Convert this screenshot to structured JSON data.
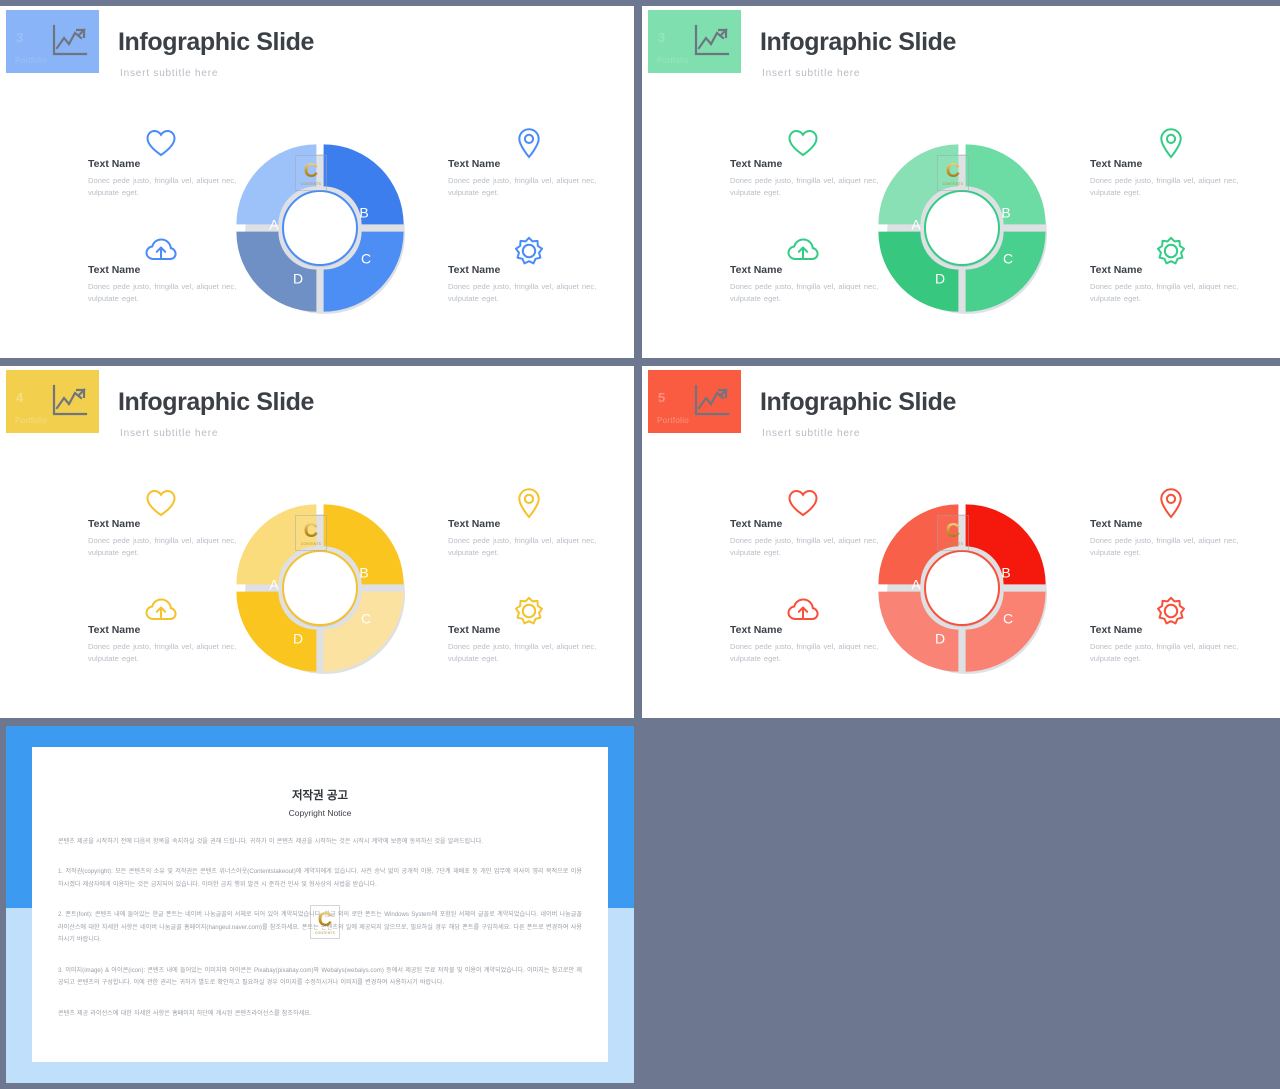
{
  "background_color": "#6d7890",
  "slides": [
    {
      "number": "3",
      "kicker": "Portfolio",
      "title": "Infographic Slide",
      "subtitle": "Insert  subtitle  here",
      "accent": "#4a8cf7",
      "badge_bg": "#89b4f7",
      "badge_text_color": "#9cc0f8",
      "chart_icon": "line-chart-icon",
      "segments": [
        {
          "label": "A",
          "color": "#9dc2fa"
        },
        {
          "label": "B",
          "color": "#3d7eee"
        },
        {
          "label": "C",
          "color": "#4d8ef5"
        },
        {
          "label": "D",
          "color": "#6f90c4"
        }
      ],
      "items": [
        {
          "icon": "heart-icon",
          "name": "Text Name",
          "desc": "Donec pede justo, fringilla vel, aliquet nec, vulputate eget."
        },
        {
          "icon": "cloud-upload-icon",
          "name": "Text Name",
          "desc": "Donec pede justo, fringilla vel, aliquet nec, vulputate eget."
        },
        {
          "icon": "map-pin-icon",
          "name": "Text Name",
          "desc": "Donec pede justo, fringilla vel, aliquet nec, vulputate eget."
        },
        {
          "icon": "gear-badge-icon",
          "name": "Text Name",
          "desc": "Donec pede justo, fringilla vel, aliquet nec, vulputate eget."
        }
      ]
    },
    {
      "number": "3",
      "kicker": "Portfolio",
      "title": "Infographic Slide",
      "subtitle": "Insert  subtitle  here",
      "accent": "#33cc85",
      "badge_bg": "#7fdfaf",
      "badge_text_color": "#96e6bf",
      "chart_icon": "line-chart-icon",
      "segments": [
        {
          "label": "A",
          "color": "#88e0b4"
        },
        {
          "label": "B",
          "color": "#6ddba4"
        },
        {
          "label": "C",
          "color": "#49d08f"
        },
        {
          "label": "D",
          "color": "#37c77f"
        }
      ],
      "items": [
        {
          "icon": "heart-icon",
          "name": "Text Name",
          "desc": "Donec pede justo, fringilla vel, aliquet nec, vulputate eget."
        },
        {
          "icon": "cloud-upload-icon",
          "name": "Text Name",
          "desc": "Donec pede justo, fringilla vel, aliquet nec, vulputate eget."
        },
        {
          "icon": "map-pin-icon",
          "name": "Text Name",
          "desc": "Donec pede justo, fringilla vel, aliquet nec, vulputate eget."
        },
        {
          "icon": "gear-badge-icon",
          "name": "Text Name",
          "desc": "Donec pede justo, fringilla vel, aliquet nec, vulputate eget."
        }
      ]
    },
    {
      "number": "4",
      "kicker": "Portfolio",
      "title": "Infographic Slide",
      "subtitle": "Insert  subtitle  here",
      "accent": "#f5c22b",
      "badge_bg": "#f3cf4e",
      "badge_text_color": "#f6dd84",
      "chart_icon": "line-chart-icon",
      "segments": [
        {
          "label": "A",
          "color": "#fadc7c"
        },
        {
          "label": "B",
          "color": "#fbc51f"
        },
        {
          "label": "C",
          "color": "#fbe2a0"
        },
        {
          "label": "D",
          "color": "#fbc51f"
        }
      ],
      "items": [
        {
          "icon": "heart-icon",
          "name": "Text Name",
          "desc": "Donec pede justo, fringilla vel, aliquet nec, vulputate eget."
        },
        {
          "icon": "cloud-upload-icon",
          "name": "Text Name",
          "desc": "Donec pede justo, fringilla vel, aliquet nec, vulputate eget."
        },
        {
          "icon": "map-pin-icon",
          "name": "Text Name",
          "desc": "Donec pede justo, fringilla vel, aliquet nec, vulputate eget."
        },
        {
          "icon": "gear-badge-icon",
          "name": "Text Name",
          "desc": "Donec pede justo, fringilla vel, aliquet nec, vulputate eget."
        }
      ]
    },
    {
      "number": "5",
      "kicker": "Portfolio",
      "title": "Infographic Slide",
      "subtitle": "Insert  subtitle  here",
      "accent": "#f8503a",
      "badge_bg": "#fa5c42",
      "badge_text_color": "#fb9280",
      "chart_icon": "line-chart-icon",
      "segments": [
        {
          "label": "A",
          "color": "#f8604a"
        },
        {
          "label": "B",
          "color": "#f5180c"
        },
        {
          "label": "C",
          "color": "#fa8273"
        },
        {
          "label": "D",
          "color": "#f98476"
        }
      ],
      "items": [
        {
          "icon": "heart-icon",
          "name": "Text Name",
          "desc": "Donec pede justo, fringilla vel, aliquet nec, vulputate eget."
        },
        {
          "icon": "cloud-upload-icon",
          "name": "Text Name",
          "desc": "Donec pede justo, fringilla vel, aliquet nec, vulputate eget."
        },
        {
          "icon": "map-pin-icon",
          "name": "Text Name",
          "desc": "Donec pede justo, fringilla vel, aliquet nec, vulputate eget."
        },
        {
          "icon": "gear-badge-icon",
          "name": "Text Name",
          "desc": "Donec pede justo, fringilla vel, aliquet nec, vulputate eget."
        }
      ]
    }
  ],
  "watermark": {
    "letter": "C",
    "caption": "CONTENTS"
  },
  "copyright_slide": {
    "frame_top_color": "#3c9af0",
    "frame_bottom_color": "#bfdffb",
    "title_ko": "저작권 공고",
    "title_en": "Copyright Notice",
    "intro": "콘텐츠 제공을 시작하기 전에 다음의 항목을 숙지하실 것을 권해 드립니다. 귀하가 이 콘텐츠 제공을 시작하는 것은 시작시 계약에 보증에 동의하신 것을 알려드립니다.",
    "sections": [
      "1. 저작권(copyright): 모든 콘텐츠의 소유 및 저작권은 콘텐츠 위너스아웃(Contentstakeout)에 계약자에게 있습니다. 사전 승낙 없이 공개적 이용, 7단계 재배포 등 개인 업무에 의사이 영리 목적으로 이용하시겠다 제삼자에게 이용하는 것은 금지되어 있습니다. 이러한 금지 행위 발견 시 준하건 민사 및 형사상의 사법을 받습니다.",
      "2. 폰트(font): 콘텐츠 내에 들어있는 한글 폰트는 네이버 나눔글꼴의 서체로 되어 있어 계약되었습니다. 한글 외의 로만 폰트는 Windows System에 포함된 서체의 글꼴로 계약되었습니다. 네이버 나눔글꼴 라이선스에 대한 자세한 사항은 네이버 나눔글꼴 홈페이지(hangeul.naver.com)를 참조하세요. 폰트는 콘텐츠의 일에 제공되지 않으므로, 필요하실 경우 해당 폰트를 구입하세요. 다른 폰트로 변경하여 사용하시기 바랍니다.",
      "3. 이미지(image) & 아이콘(icon): 콘텐츠 내에 들어있는 이미지와 아이콘은 Pixabay(pixabay.com)와 Webalys(webalys.com) 등에서 제공된 무료 저작물 및 이용이 계약되었습니다. 이미지는 참고로만 제공되고 콘텐츠의 구성합니다. 이에 관한 권리는 귀하가 별도로 확인하고 필요하실 경우 이미지를 수정하시거나 이미지를 변경하여 사용하시기 바랍니다."
    ],
    "footer": "콘텐츠 제공 라이선스에 대한 자세한 사항은 홈페이지 하단에 게시된 콘텐츠라이선스를 참조하세요."
  }
}
